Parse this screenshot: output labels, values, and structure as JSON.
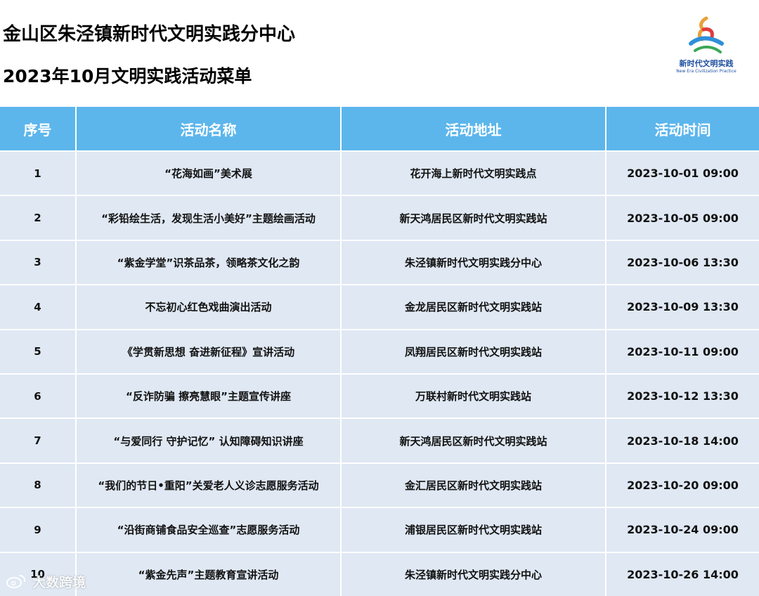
{
  "header": {
    "title": "金山区朱泾镇新时代文明实践分中心",
    "subtitle": "2023年10月文明实践活动菜单"
  },
  "logo": {
    "cn": "新时代文明实践",
    "en": "New Era Civilization Practice",
    "colors": [
      "#e8a13a",
      "#2f8fd8",
      "#e03b3b",
      "#3aa856"
    ]
  },
  "table": {
    "header_color": "#5cb6ec",
    "row_color": "#dfe8f3",
    "columns": [
      "序号",
      "活动名称",
      "活动地址",
      "活动时间"
    ],
    "rows": [
      {
        "no": "1",
        "name": "“花海如画”美术展",
        "address": "花开海上新时代文明实践点",
        "time": "2023-10-01 09:00"
      },
      {
        "no": "2",
        "name": "“彩铅绘生活，发现生活小美好”主题绘画活动",
        "address": "新天鸿居民区新时代文明实践站",
        "time": "2023-10-05 09:00"
      },
      {
        "no": "3",
        "name": "“紫金学堂”识茶品茶，领略茶文化之韵",
        "address": "朱泾镇新时代文明实践分中心",
        "time": "2023-10-06 13:30"
      },
      {
        "no": "4",
        "name": "不忘初心红色戏曲演出活动",
        "address": "金龙居民区新时代文明实践站",
        "time": "2023-10-09 13:30"
      },
      {
        "no": "5",
        "name": "《学贯新思想 奋进新征程》宣讲活动",
        "address": "凤翔居民区新时代文明实践站",
        "time": "2023-10-11 09:00"
      },
      {
        "no": "6",
        "name": "“反诈防骗 擦亮慧眼”主题宣传讲座",
        "address": "万联村新时代文明实践站",
        "time": "2023-10-12 13:30"
      },
      {
        "no": "7",
        "name": "“与爱同行 守护记忆” 认知障碍知识讲座",
        "address": "新天鸿居民区新时代文明实践站",
        "time": "2023-10-18 14:00"
      },
      {
        "no": "8",
        "name": "“我们的节日•重阳”关爱老人义诊志愿服务活动",
        "address": "金汇居民区新时代文明实践站",
        "time": "2023-10-20 09:00"
      },
      {
        "no": "9",
        "name": "“沿街商铺食品安全巡查”志愿服务活动",
        "address": "浦银居民区新时代文明实践站",
        "time": "2023-10-24 09:00"
      },
      {
        "no": "10",
        "name": "“紫金先声”主题教育宣讲活动",
        "address": "朱泾镇新时代文明实践分中心",
        "time": "2023-10-26 14:00"
      }
    ]
  },
  "watermark": {
    "text": "大数跨境",
    "icon": "weibo-like-icon"
  }
}
